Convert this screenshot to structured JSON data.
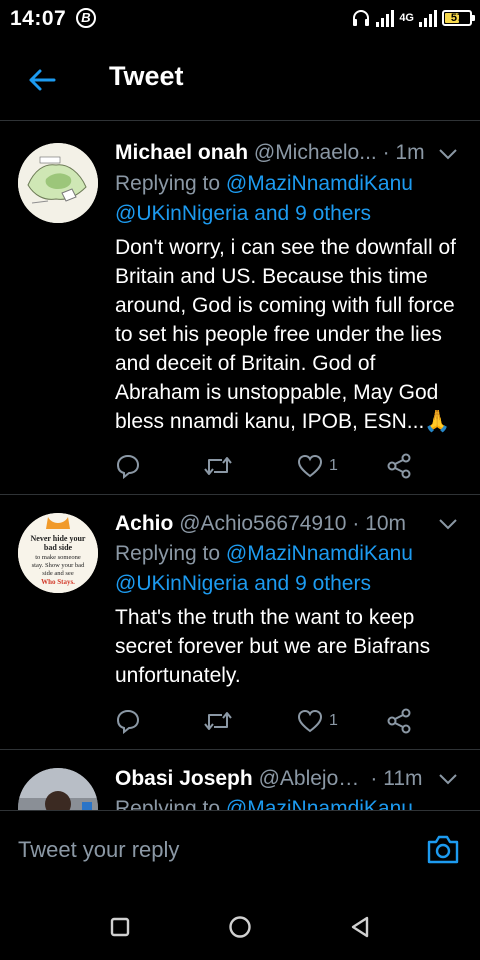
{
  "status_bar": {
    "time": "14:07",
    "battery": "57",
    "battery_level": 0.57,
    "network": "4G"
  },
  "header": {
    "title": "Tweet"
  },
  "tweets": [
    {
      "name": "Michael onah",
      "handle": "@Michaelo...",
      "time": "· 1m",
      "replying_to": "Replying to",
      "mention_1": "@MaziNnamdiKanu",
      "mention_2": "@UKinNigeria and 9 others",
      "text": "Don't worry, i can see the downfall of Britain and US. Because this time around, God is coming with full force to set his people free under the lies and deceit of Britain. God of Abraham is unstoppable, May God bless nnamdi kanu, IPOB, ESN...🙏",
      "likes": "1"
    },
    {
      "name": "Achio",
      "handle": "@Achio56674910",
      "time": "· 10m",
      "replying_to": "Replying to",
      "mention_1": "@MaziNnamdiKanu",
      "mention_2": "@UKinNigeria and 9 others",
      "text": "That's the truth the want to keep secret forever but we are Biafrans unfortunately.",
      "likes": "1",
      "avatar_text": [
        "Never hide your",
        "bad side",
        "to make someone",
        "stay. Show your bad",
        "side and see",
        "Who Stays."
      ]
    },
    {
      "name": "Obasi Joseph",
      "handle": "@Ablejoe...",
      "time": "· 11m",
      "replying_to": "Replying to",
      "mention_1": "@MaziNnamdiKanu"
    }
  ],
  "reply_bar": {
    "placeholder": "Tweet your reply"
  },
  "colors": {
    "accent": "#1d9bf0",
    "muted": "#8b98a5",
    "background": "#000000",
    "divider": "#2f3336"
  },
  "icons": [
    "back-arrow-icon",
    "chevron-down-icon",
    "reply-icon",
    "retweet-icon",
    "like-icon",
    "share-icon",
    "camera-icon",
    "square-icon",
    "circle-icon",
    "triangle-back-icon"
  ]
}
